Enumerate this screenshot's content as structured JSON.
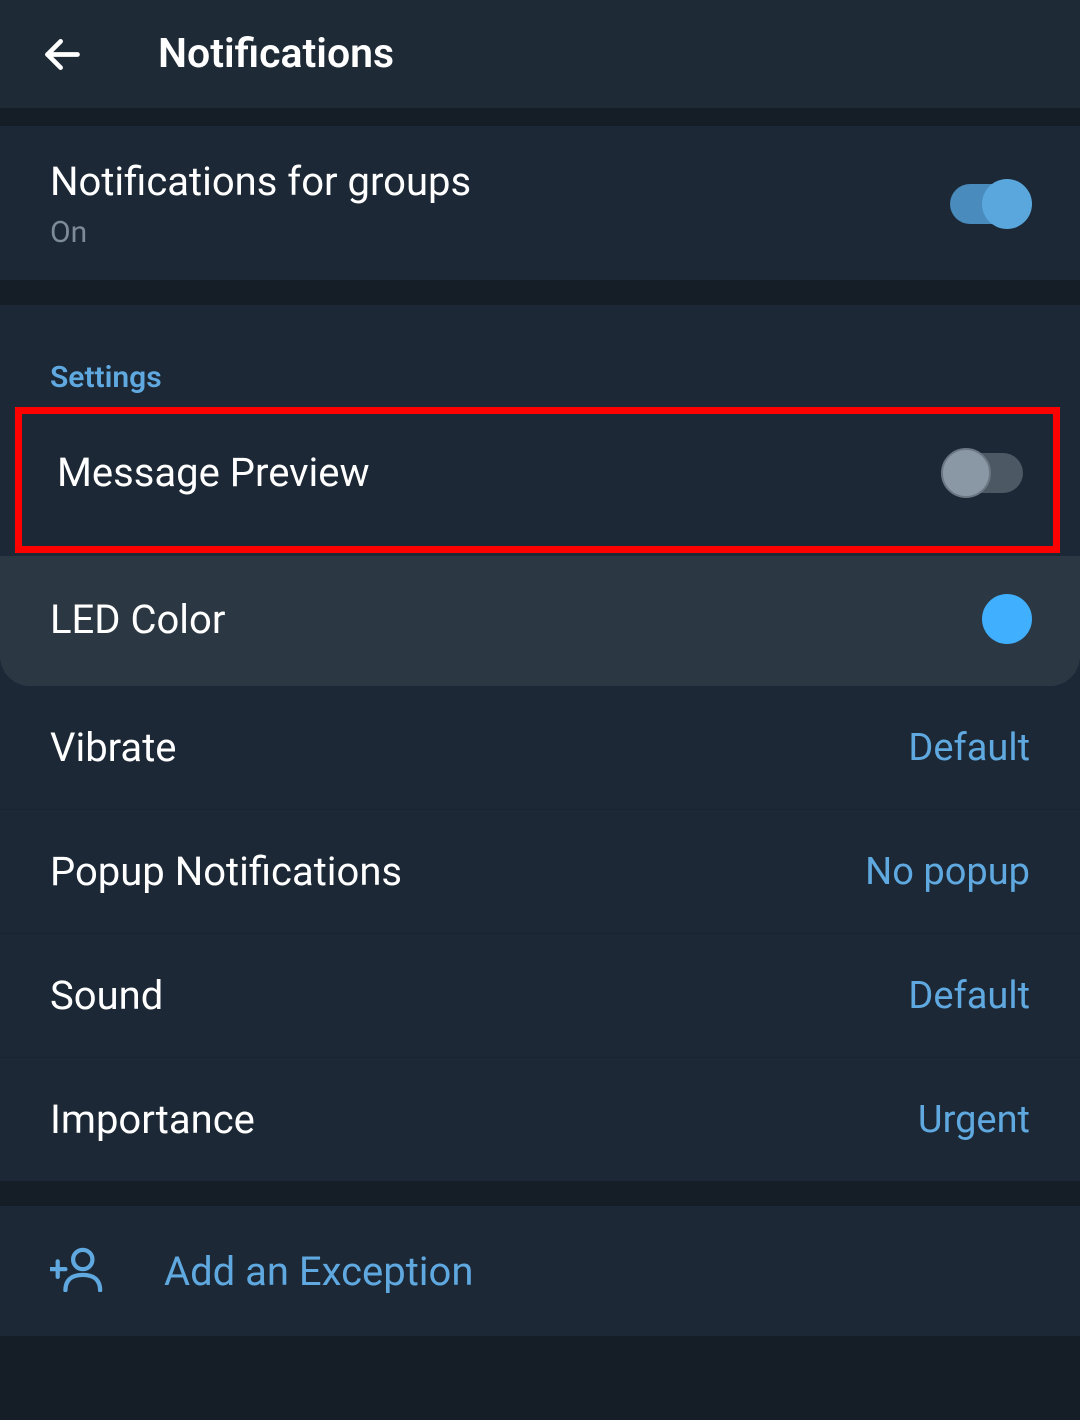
{
  "header": {
    "title": "Notifications"
  },
  "main": {
    "groups": {
      "title": "Notifications for groups",
      "status": "On"
    }
  },
  "settings": {
    "header": "Settings",
    "message_preview": {
      "title": "Message Preview"
    },
    "led_color": {
      "title": "LED Color"
    },
    "vibrate": {
      "title": "Vibrate",
      "value": "Default"
    },
    "popup": {
      "title": "Popup Notifications",
      "value": "No popup"
    },
    "sound": {
      "title": "Sound",
      "value": "Default"
    },
    "importance": {
      "title": "Importance",
      "value": "Urgent"
    }
  },
  "exception": {
    "label": "Add an Exception"
  }
}
